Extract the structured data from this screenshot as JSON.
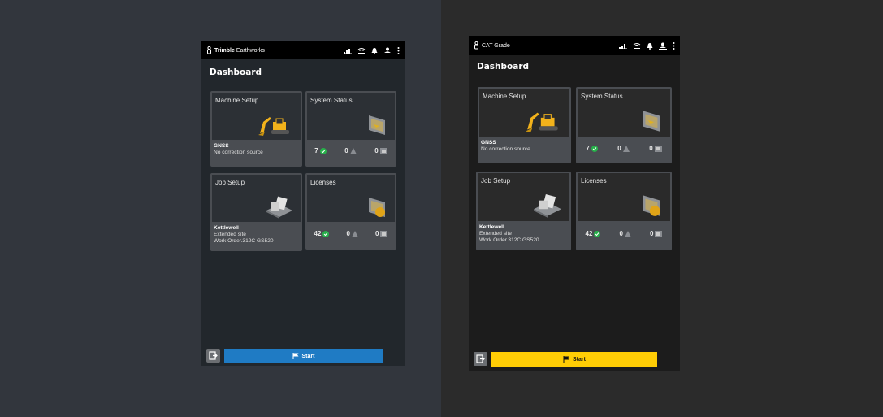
{
  "devices": [
    {
      "brand_bold": "Trimble",
      "brand_rest": " Earthworks",
      "dashboard_title": "Dashboard",
      "machine_setup": {
        "title": "Machine Setup",
        "status_title": "GNSS",
        "status_detail": "No correction source"
      },
      "system_status": {
        "title": "System Status",
        "ok_count": "7",
        "warn_count": "0",
        "error_count": "0"
      },
      "job_setup": {
        "title": "Job Setup",
        "name": "Kettlewell",
        "line2": "Extended site",
        "line3": "Work Order.312C GS520"
      },
      "licenses": {
        "title": "Licenses",
        "ok_count": "42",
        "warn_count": "0",
        "error_count": "0"
      },
      "start_label": "Start",
      "accent": "#1f7bc4"
    },
    {
      "brand_bold": "",
      "brand_rest": "CAT Grade",
      "dashboard_title": "Dashboard",
      "machine_setup": {
        "title": "Machine Setup",
        "status_title": "GNSS",
        "status_detail": "No correction source"
      },
      "system_status": {
        "title": "System Status",
        "ok_count": "7",
        "warn_count": "0",
        "error_count": "0"
      },
      "job_setup": {
        "title": "Job Setup",
        "name": "Kettlewell",
        "line2": "Extended site",
        "line3": "Work Order.312C GS520"
      },
      "licenses": {
        "title": "Licenses",
        "ok_count": "42",
        "warn_count": "0",
        "error_count": "0"
      },
      "start_label": "Start",
      "accent": "#ffcd05"
    }
  ],
  "icons": {
    "statusbar": [
      "signal-icon",
      "wifi-icon",
      "bell-icon",
      "user-icon",
      "more-vertical-icon"
    ],
    "brand": "trimble-logo-icon",
    "cards": [
      "excavator-icon",
      "display-monitor-icon",
      "job-papers-icon",
      "license-tablet-icon"
    ],
    "counts": [
      "check-ok-icon",
      "warning-icon",
      "error-icon"
    ],
    "bottom": [
      "exit-icon",
      "flag-icon"
    ]
  }
}
